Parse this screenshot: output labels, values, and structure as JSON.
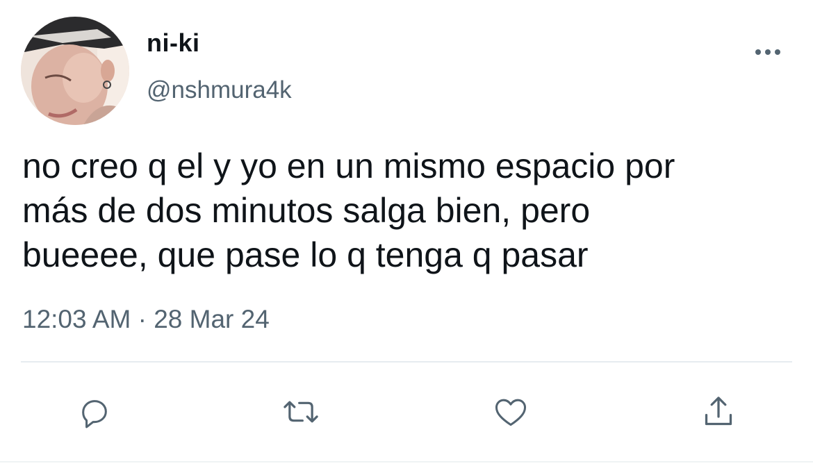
{
  "user": {
    "display_name": "ni-ki",
    "handle": "@nshmura4k"
  },
  "tweet": {
    "text_lines": [
      "no creo q el y yo en un mismo espacio por",
      "más de dos minutos salga bien, pero",
      "bueeee, que pase lo q tenga q pasar"
    ],
    "timestamp": "12:03 AM · 28 Mar 24"
  },
  "icons": {
    "more": "more-horizontal-icon",
    "reply": "reply-icon",
    "retweet": "retweet-icon",
    "like": "heart-icon",
    "share": "share-icon"
  },
  "colors": {
    "text": "#0f1419",
    "secondary": "#536471",
    "icon": "#536471",
    "divider": "#e6ecf0"
  }
}
